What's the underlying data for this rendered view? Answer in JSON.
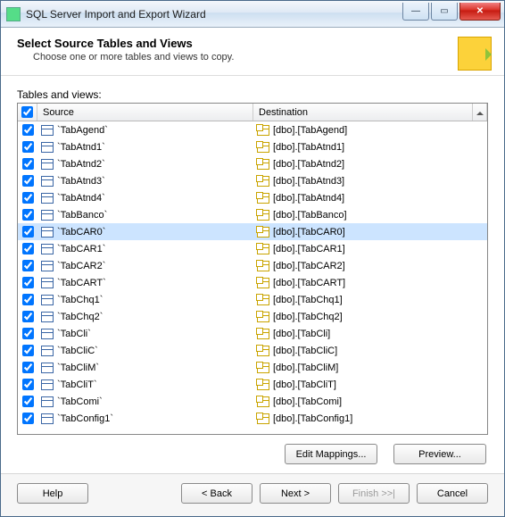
{
  "window": {
    "title": "SQL Server Import and Export Wizard"
  },
  "header": {
    "title": "Select Source Tables and Views",
    "subtitle": "Choose one or more tables and views to copy."
  },
  "grid": {
    "label": "Tables and views:",
    "columns": {
      "source": "Source",
      "destination": "Destination"
    },
    "selectAll": true,
    "rows": [
      {
        "checked": true,
        "source": "`TabAgend`",
        "destination": "[dbo].[TabAgend]",
        "selected": false
      },
      {
        "checked": true,
        "source": "`TabAtnd1`",
        "destination": "[dbo].[TabAtnd1]",
        "selected": false
      },
      {
        "checked": true,
        "source": "`TabAtnd2`",
        "destination": "[dbo].[TabAtnd2]",
        "selected": false
      },
      {
        "checked": true,
        "source": "`TabAtnd3`",
        "destination": "[dbo].[TabAtnd3]",
        "selected": false
      },
      {
        "checked": true,
        "source": "`TabAtnd4`",
        "destination": "[dbo].[TabAtnd4]",
        "selected": false
      },
      {
        "checked": true,
        "source": "`TabBanco`",
        "destination": "[dbo].[TabBanco]",
        "selected": false
      },
      {
        "checked": true,
        "source": "`TabCAR0`",
        "destination": "[dbo].[TabCAR0]",
        "selected": true
      },
      {
        "checked": true,
        "source": "`TabCAR1`",
        "destination": "[dbo].[TabCAR1]",
        "selected": false
      },
      {
        "checked": true,
        "source": "`TabCAR2`",
        "destination": "[dbo].[TabCAR2]",
        "selected": false
      },
      {
        "checked": true,
        "source": "`TabCART`",
        "destination": "[dbo].[TabCART]",
        "selected": false
      },
      {
        "checked": true,
        "source": "`TabChq1`",
        "destination": "[dbo].[TabChq1]",
        "selected": false
      },
      {
        "checked": true,
        "source": "`TabChq2`",
        "destination": "[dbo].[TabChq2]",
        "selected": false
      },
      {
        "checked": true,
        "source": "`TabCli`",
        "destination": "[dbo].[TabCli]",
        "selected": false
      },
      {
        "checked": true,
        "source": "`TabCliC`",
        "destination": "[dbo].[TabCliC]",
        "selected": false
      },
      {
        "checked": true,
        "source": "`TabCliM`",
        "destination": "[dbo].[TabCliM]",
        "selected": false
      },
      {
        "checked": true,
        "source": "`TabCliT`",
        "destination": "[dbo].[TabCliT]",
        "selected": false
      },
      {
        "checked": true,
        "source": "`TabComi`",
        "destination": "[dbo].[TabComi]",
        "selected": false
      },
      {
        "checked": true,
        "source": "`TabConfig1`",
        "destination": "[dbo].[TabConfig1]",
        "selected": false
      }
    ]
  },
  "buttons": {
    "editMappings": "Edit Mappings...",
    "preview": "Preview...",
    "help": "Help",
    "back": "< Back",
    "next": "Next >",
    "finish": "Finish >>|",
    "cancel": "Cancel"
  }
}
